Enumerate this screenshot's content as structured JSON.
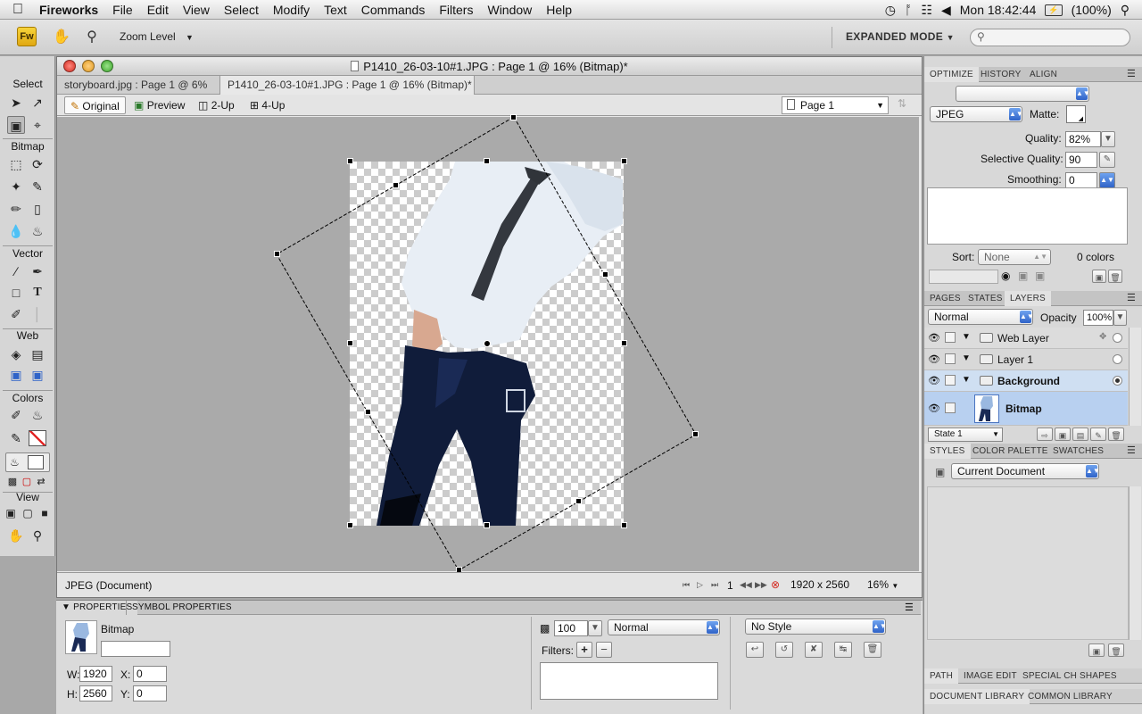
{
  "menubar": {
    "app_name": "Fireworks",
    "items": [
      "File",
      "Edit",
      "View",
      "Select",
      "Modify",
      "Text",
      "Commands",
      "Filters",
      "Window",
      "Help"
    ],
    "clock": "Mon 18:42:44",
    "battery": "(100%)"
  },
  "toolbar": {
    "logo": "Fw",
    "zoom_level_label": "Zoom Level",
    "expanded_mode_label": "EXPANDED MODE"
  },
  "tools": {
    "sections": [
      "Select",
      "Bitmap",
      "Vector",
      "Web",
      "Colors",
      "View"
    ]
  },
  "document": {
    "title": "P1410_26-03-10#1.JPG : Page 1 @ 16% (Bitmap)*",
    "tabs": [
      {
        "label": "storyboard.jpg : Page 1 @ 6%"
      },
      {
        "label": "P1410_26-03-10#1.JPG : Page 1 @ 16% (Bitmap)*"
      }
    ],
    "view_buttons": [
      "Original",
      "Preview",
      "2-Up",
      "4-Up"
    ],
    "page_select": "Page 1",
    "status": {
      "file_type": "JPEG (Document)",
      "frame_number": "1",
      "dimensions": "1920 x 2560",
      "zoom": "16%"
    }
  },
  "properties": {
    "tabs": [
      "PROPERTIES",
      "SYMBOL PROPERTIES"
    ],
    "object_name": "Bitmap",
    "w_label": "W:",
    "w_value": "1920",
    "h_label": "H:",
    "h_value": "2560",
    "x_label": "X:",
    "x_value": "0",
    "y_label": "Y:",
    "y_value": "0",
    "opacity_value": "100",
    "blend_mode": "Normal",
    "filters_label": "Filters:",
    "style_select": "No Style"
  },
  "optimize": {
    "tabs": [
      "OPTIMIZE",
      "HISTORY",
      "ALIGN"
    ],
    "format": "JPEG",
    "matte_label": "Matte:",
    "quality_label": "Quality:",
    "quality_value": "82%",
    "selective_quality_label": "Selective Quality:",
    "selective_quality_value": "90",
    "smoothing_label": "Smoothing:",
    "smoothing_value": "0",
    "sort_label": "Sort:",
    "sort_value": "None",
    "colors_count": "0 colors"
  },
  "layers": {
    "tabs": [
      "PAGES",
      "STATES",
      "LAYERS"
    ],
    "blend_mode": "Normal",
    "opacity_label": "Opacity",
    "opacity_value": "100%",
    "rows": [
      {
        "name": "Web Layer"
      },
      {
        "name": "Layer 1"
      },
      {
        "name": "Background"
      },
      {
        "name": "Bitmap"
      }
    ],
    "state_select": "State 1"
  },
  "styles": {
    "tabs": [
      "STYLES",
      "COLOR PALETTE",
      "SWATCHES"
    ],
    "select": "Current Document"
  },
  "bottom_tabs": {
    "row1": [
      "PATH",
      "IMAGE EDIT",
      "SPECIAL CH",
      "SHAPES"
    ],
    "row2": [
      "DOCUMENT LIBRARY",
      "COMMON LIBRARY"
    ]
  },
  "colors": {
    "selection_blue": "#b8d0f0",
    "active_dropdown": "#2f63c8",
    "fw_logo": "#e0a812"
  }
}
